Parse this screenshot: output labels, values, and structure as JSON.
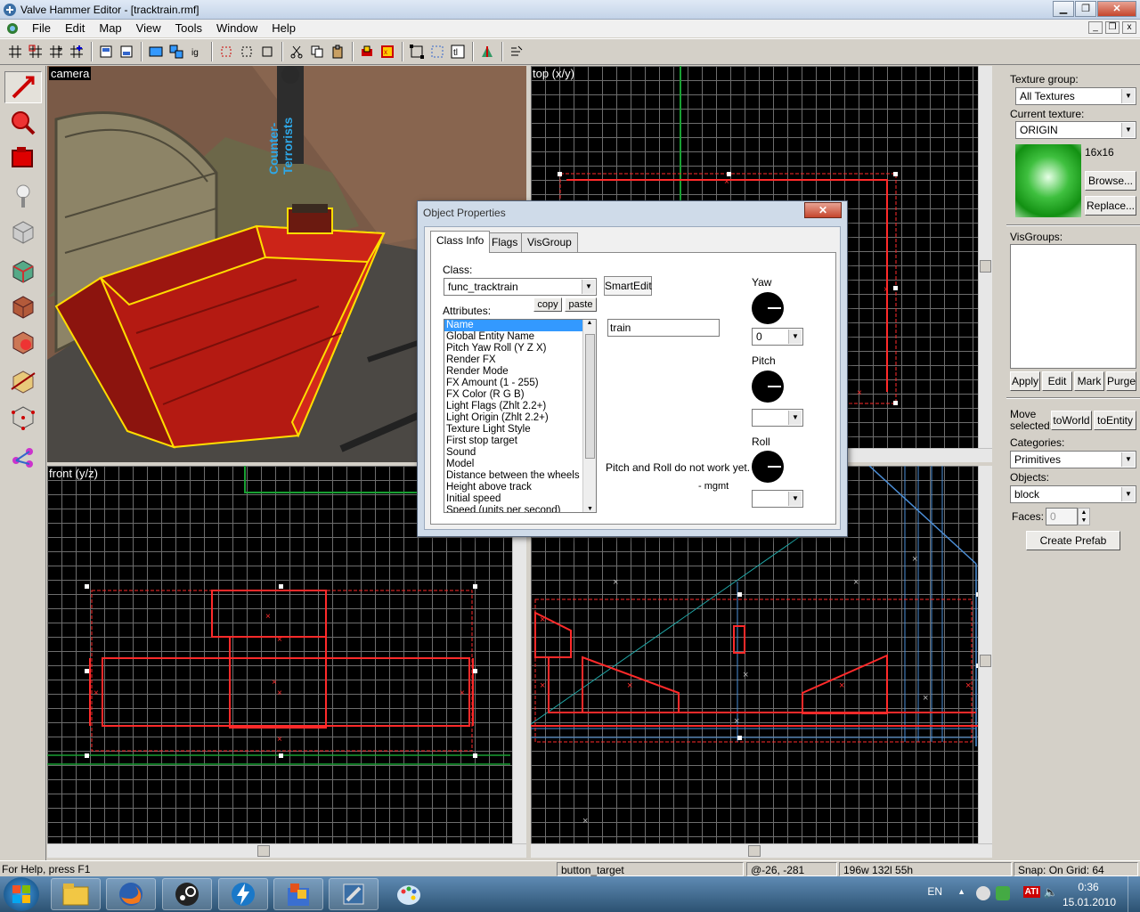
{
  "window": {
    "title": "Valve Hammer Editor - [tracktrain.rmf]"
  },
  "menubar": {
    "items": [
      "File",
      "Edit",
      "Map",
      "View",
      "Tools",
      "Window",
      "Help"
    ]
  },
  "viewports": {
    "camera_label": "camera",
    "top_label": "top (x/y)",
    "front_label": "front (y/z)",
    "camera_sign_text": "Counter-Terrorists"
  },
  "rightpanel": {
    "texture_group_label": "Texture group:",
    "texture_group_value": "All Textures",
    "current_texture_label": "Current texture:",
    "current_texture_value": "ORIGIN",
    "texture_size": "16x16",
    "browse_label": "Browse...",
    "replace_label": "Replace...",
    "visgroups_label": "VisGroups:",
    "apply_label": "Apply",
    "edit_label": "Edit",
    "mark_label": "Mark",
    "purge_label": "Purge",
    "move_selected_label": "Move\nselected:",
    "to_world_label": "toWorld",
    "to_entity_label": "toEntity",
    "categories_label": "Categories:",
    "categories_value": "Primitives",
    "objects_label": "Objects:",
    "objects_value": "block",
    "faces_label": "Faces:",
    "faces_value": "0",
    "create_prefab_label": "Create Prefab"
  },
  "dialog": {
    "title": "Object Properties",
    "close_label": "✕",
    "tabs": [
      "Class Info",
      "Flags",
      "VisGroup"
    ],
    "class_label": "Class:",
    "class_value": "func_tracktrain",
    "smartedit_label": "SmartEdit",
    "attributes_label": "Attributes:",
    "copy_label": "copy",
    "paste_label": "paste",
    "attributes": [
      "Name",
      "Global Entity Name",
      "Pitch Yaw Roll (Y Z X)",
      "Render FX",
      "Render Mode",
      "FX Amount (1 - 255)",
      "FX Color (R G B)",
      "Light Flags (Zhlt 2.2+)",
      "Light Origin (Zhlt 2.2+)",
      "Texture Light Style",
      "First stop target",
      "Sound",
      "Model",
      "Distance between the wheels",
      "Height above track",
      "Initial speed",
      "Speed (units per second)"
    ],
    "value_text": "train",
    "yaw_label": "Yaw",
    "yaw_value": "0",
    "pitch_label": "Pitch",
    "pitch_value": "",
    "roll_label": "Roll",
    "roll_value": "",
    "note_text": "Pitch and Roll do not work yet. ->",
    "note_author": "- mgmt"
  },
  "statusbar": {
    "help": "For Help, press F1",
    "target": "button_target",
    "coords": "@-26, -281",
    "size": "196w 132l 55h",
    "snap": "Snap: On Grid: 64"
  },
  "tray": {
    "lang": "EN",
    "ati": "ATI",
    "time": "0:36",
    "date": "15.01.2010"
  },
  "colors": {
    "selection": "#ff0000",
    "grid": "#6d6d6d",
    "accent": "#3399ff"
  }
}
